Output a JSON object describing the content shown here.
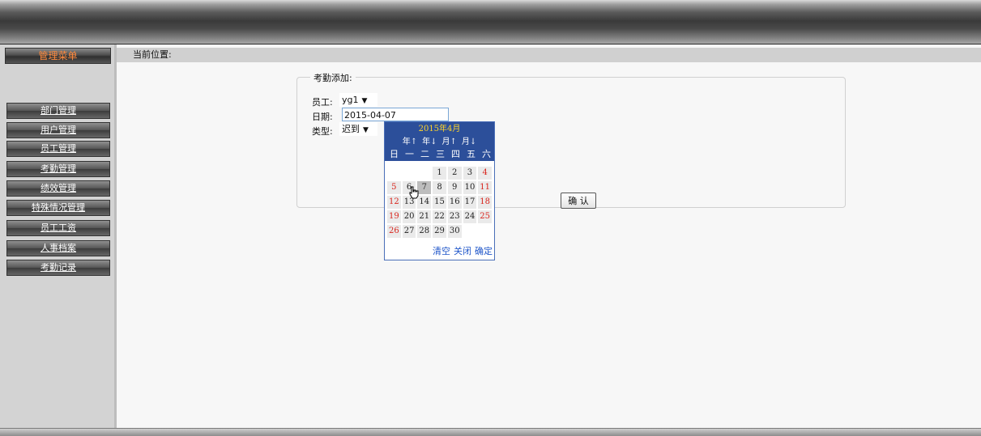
{
  "sidebar": {
    "header": "管理菜单",
    "items": [
      {
        "label": "部门管理"
      },
      {
        "label": "用户管理"
      },
      {
        "label": "员工管理"
      },
      {
        "label": "考勤管理"
      },
      {
        "label": "绩效管理"
      },
      {
        "label": "特殊情况管理"
      },
      {
        "label": "员工工资"
      },
      {
        "label": "人事档案"
      },
      {
        "label": "考勤记录"
      }
    ]
  },
  "location": {
    "label": "当前位置:"
  },
  "form": {
    "legend": "考勤添加:",
    "employee_label": "员工:",
    "employee_value": "yg1",
    "date_label": "日期:",
    "date_value": "2015-04-07",
    "type_label": "类型:",
    "type_value": "迟到",
    "confirm_label": "确 认"
  },
  "calendar": {
    "title": "2015年4月",
    "nav": [
      "年↑",
      "年↓",
      "月↑",
      "月↓"
    ],
    "weekdays": [
      "日",
      "一",
      "二",
      "三",
      "四",
      "五",
      "六"
    ],
    "weeks": [
      [
        "",
        "",
        "",
        "1",
        "2",
        "3",
        "4"
      ],
      [
        "5",
        "6",
        "7",
        "8",
        "9",
        "10",
        "11"
      ],
      [
        "12",
        "13",
        "14",
        "15",
        "16",
        "17",
        "18"
      ],
      [
        "19",
        "20",
        "21",
        "22",
        "23",
        "24",
        "25"
      ],
      [
        "26",
        "27",
        "28",
        "29",
        "30",
        "",
        ""
      ]
    ],
    "selected_day": "7",
    "footer": [
      "清空",
      "关闭",
      "确定"
    ]
  },
  "colors": {
    "sidebar_header_text": "#ff8a3d",
    "calendar_header_bg": "#2c4f9a",
    "calendar_title_text": "#ffd42a",
    "weekend_text": "#d9251d",
    "footer_link": "#1f56c9"
  }
}
